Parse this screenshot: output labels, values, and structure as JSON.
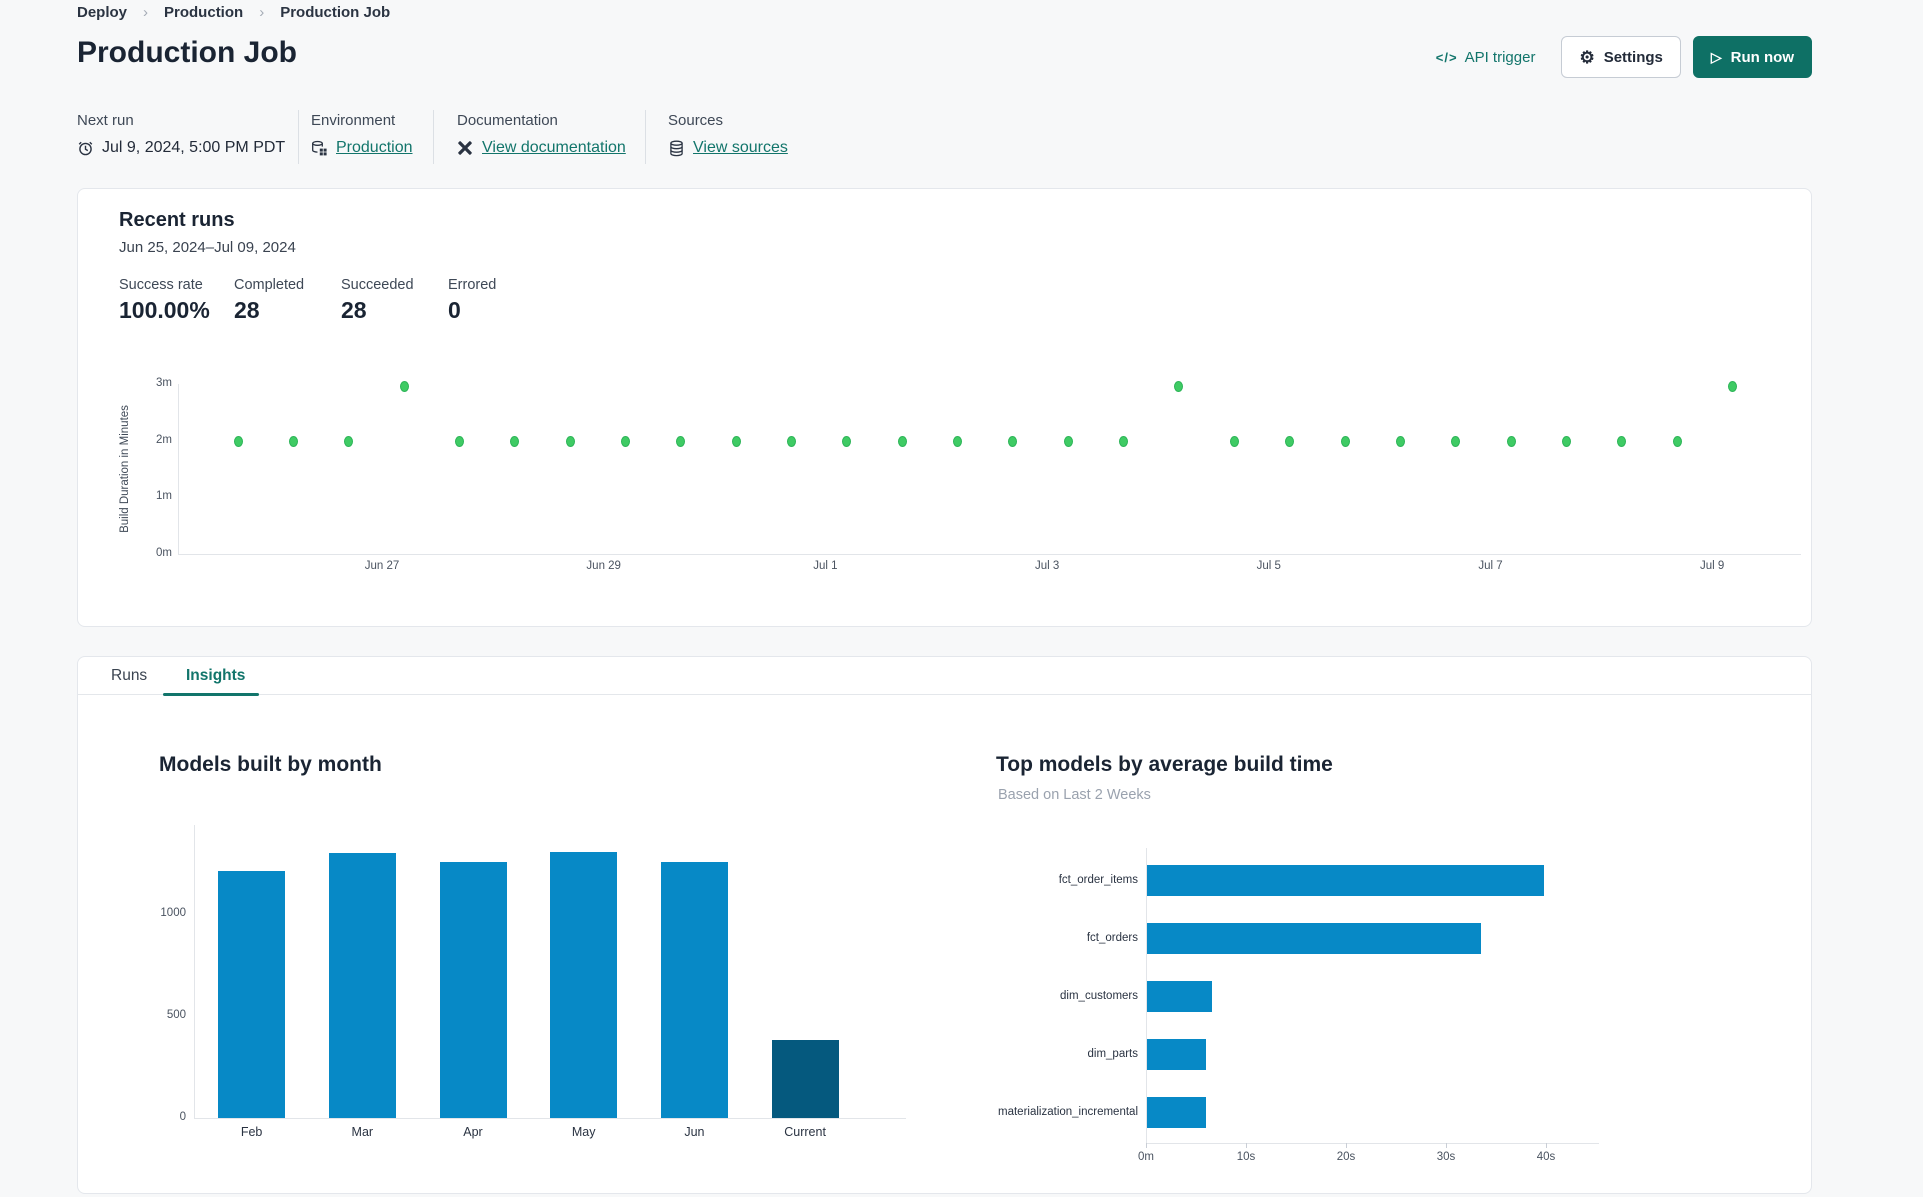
{
  "breadcrumb": {
    "items": [
      "Deploy",
      "Production",
      "Production Job"
    ]
  },
  "header": {
    "title": "Production Job",
    "api_trigger_label": "API trigger",
    "settings_label": "Settings",
    "run_now_label": "Run now"
  },
  "meta": {
    "next_run": {
      "label": "Next run",
      "value": "Jul 9, 2024, 5:00 PM PDT"
    },
    "environment": {
      "label": "Environment",
      "link": "Production"
    },
    "documentation": {
      "label": "Documentation",
      "link": "View documentation"
    },
    "sources": {
      "label": "Sources",
      "link": "View sources"
    }
  },
  "recent_runs": {
    "title": "Recent runs",
    "date_range": "Jun 25, 2024–Jul 09, 2024",
    "stats": [
      {
        "label": "Success rate",
        "value": "100.00%"
      },
      {
        "label": "Completed",
        "value": "28"
      },
      {
        "label": "Succeeded",
        "value": "28"
      },
      {
        "label": "Errored",
        "value": "0"
      }
    ]
  },
  "tabs": {
    "items": [
      {
        "label": "Runs"
      },
      {
        "label": "Insights"
      }
    ],
    "active_index": 1
  },
  "colors": {
    "accent_teal": "#12756b",
    "run_button": "#0e7065",
    "success_green": "#3fcb64",
    "bar_blue": "#0789c6",
    "bar_dark_blue": "#05597e"
  },
  "chart_data": [
    {
      "id": "build_duration_scatter",
      "type": "scatter",
      "ylabel": "Build Duration in Minutes",
      "ytick_labels": [
        "0m",
        "1m",
        "2m",
        "3m"
      ],
      "ymax_minutes": 3,
      "xtick_labels": [
        "Jun 27",
        "Jun 29",
        "Jul 1",
        "Jul 3",
        "Jul 5",
        "Jul 7",
        "Jul 9"
      ],
      "runs_per_day": 2,
      "points_minutes": [
        1.99,
        1.99,
        1.99,
        2.96,
        1.99,
        1.99,
        1.99,
        1.99,
        1.99,
        1.99,
        1.99,
        1.99,
        1.99,
        1.99,
        1.99,
        1.99,
        1.99,
        2.96,
        1.99,
        1.99,
        1.99,
        1.99,
        1.99,
        1.99,
        1.99,
        1.99,
        1.99,
        2.96
      ],
      "point_color": "#3fcb64",
      "grid": "off",
      "legend_position": "none"
    },
    {
      "id": "models_built_by_month",
      "type": "bar",
      "title": "Models built by month",
      "categories": [
        "Feb",
        "Mar",
        "Apr",
        "May",
        "Jun",
        "Current"
      ],
      "values": [
        1210,
        1300,
        1255,
        1305,
        1255,
        380
      ],
      "ytick_values": [
        0,
        500,
        1000
      ],
      "ylim": [
        0,
        1400
      ],
      "bar_color": "#0789c6",
      "last_bar_color": "#05597e",
      "grid": "off"
    },
    {
      "id": "top_models_by_avg_build_time",
      "type": "bar",
      "orientation": "horizontal",
      "title": "Top models by average build time",
      "subtitle": "Based on Last 2 Weeks",
      "categories": [
        "fct_order_items",
        "fct_orders",
        "dim_customers",
        "dim_parts",
        "materialization_incremental"
      ],
      "values_seconds": [
        39.7,
        33.4,
        6.5,
        5.9,
        5.9
      ],
      "xtick_labels": [
        "0m",
        "10s",
        "20s",
        "30s",
        "40s"
      ],
      "xlim_seconds": [
        0,
        45
      ],
      "bar_color": "#0789c6",
      "grid": "off"
    }
  ]
}
